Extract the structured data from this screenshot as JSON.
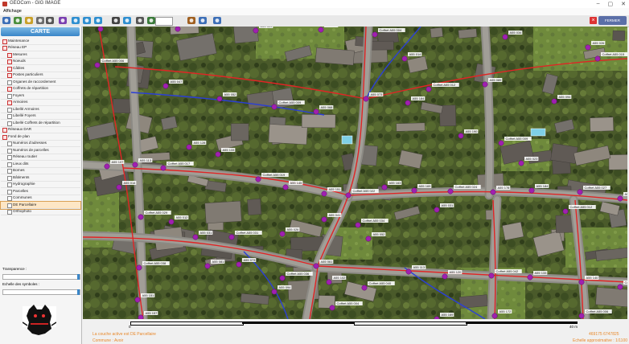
{
  "window": {
    "title": "GEOCom - GIG IMAGE",
    "menu": "Affichage"
  },
  "toolbar": {
    "scale_value": "",
    "close_label": "FERMER",
    "buttons": [
      "home-icon",
      "back-icon",
      "refresh-icon",
      "print-icon",
      "map-icon",
      "layer-icon",
      "zoom-in-icon",
      "zoom-out-icon",
      "pan-icon",
      "measure-icon",
      "info-icon",
      "pointer-icon",
      "select-icon",
      "export-icon",
      "search-icon",
      "gps-icon"
    ]
  },
  "panel": {
    "header": "CARTE",
    "tree": [
      {
        "label": "Maintenance",
        "level": 0,
        "type": "group"
      },
      {
        "label": "Réseau EP",
        "level": 0,
        "type": "group"
      },
      {
        "label": "Mesures",
        "level": 1,
        "type": "group"
      },
      {
        "label": "Noeuds",
        "level": 1,
        "type": "group"
      },
      {
        "label": "Câbles",
        "level": 1,
        "type": "group"
      },
      {
        "label": "Postes particuliers",
        "level": 1,
        "type": "group"
      },
      {
        "label": "Organes de raccordement",
        "level": 1,
        "type": "check"
      },
      {
        "label": "Coffrets de répartition",
        "level": 1,
        "type": "group"
      },
      {
        "label": "Foyers",
        "level": 1,
        "type": "check"
      },
      {
        "label": "Armoires",
        "level": 1,
        "type": "group"
      },
      {
        "label": "Libellé Armoires",
        "level": 1,
        "type": "check"
      },
      {
        "label": "Libellé Foyers",
        "level": 1,
        "type": "check"
      },
      {
        "label": "Libellé Coffrets de répartition",
        "level": 1,
        "type": "check"
      },
      {
        "label": "Réseaux DAR",
        "level": 0,
        "type": "group"
      },
      {
        "label": "Fond de plan",
        "level": 0,
        "type": "group"
      },
      {
        "label": "Numéros d'adresses",
        "level": 1,
        "type": "check"
      },
      {
        "label": "Numéros de parcelles",
        "level": 1,
        "type": "check"
      },
      {
        "label": "Réseau routier",
        "level": 1,
        "type": "check"
      },
      {
        "label": "Lieux dits",
        "level": 1,
        "type": "check"
      },
      {
        "label": "Bornes",
        "level": 1,
        "type": "check"
      },
      {
        "label": "Bâtiments",
        "level": 1,
        "type": "check"
      },
      {
        "label": "Hydrographie",
        "level": 1,
        "type": "check"
      },
      {
        "label": "Parcelles",
        "level": 1,
        "type": "check"
      },
      {
        "label": "Communes",
        "level": 1,
        "type": "check"
      },
      {
        "label": "DE Parcellaire",
        "level": 1,
        "type": "check",
        "selected": true
      },
      {
        "label": "Orthophoto",
        "level": 1,
        "type": "check"
      }
    ],
    "transparence_label": "Transparence :",
    "symbols_label": "Echelle des symboles :"
  },
  "map": {
    "foyer_labels": [
      "A55 011",
      "A55 014",
      "A55 023",
      "A55 012",
      "A55 031",
      "A55 034",
      "A55 026",
      "A55 041",
      "A55 047",
      "A55 052",
      "A55 061",
      "A55 068",
      "A55 073",
      "A55 081",
      "A55 089",
      "A55 094",
      "A55 102",
      "A55 107",
      "A55 113",
      "A55 120",
      "A55 128",
      "A55 133",
      "A55 140",
      "A55 145",
      "A55 151",
      "A55 157",
      "A55 163",
      "A55 169",
      "A55 172",
      "A55 178",
      "A55 184",
      "A55 190"
    ],
    "coffret_labels": [
      "Coffret A55 001",
      "Coffret A55 004",
      "Coffret A55 006",
      "Coffret A55 009",
      "Coffret A55 012",
      "Coffret A55 015",
      "Coffret A55 017",
      "Coffret A55 019",
      "Coffret A55 022",
      "Coffret A55 024",
      "Coffret A55 027",
      "Coffret A55 029",
      "Coffret A55 031",
      "Coffret A55 034",
      "Coffret A55 036",
      "Coffret A55 038",
      "Coffret A55 040",
      "Coffret A55 042"
    ],
    "colors": {
      "cable_red": "#e02525",
      "cable_blue": "#2b3fd6",
      "foyer": "#a020b0",
      "road": "#8c8a84"
    }
  },
  "scalebar": {
    "left": "0",
    "right": "40 m"
  },
  "status": {
    "line1": "La couche active est DE Parcellaire",
    "line2": "Commune : Avoir",
    "coords": "469175 6747825",
    "echelle": "Echelle approximative : 1/1100"
  }
}
